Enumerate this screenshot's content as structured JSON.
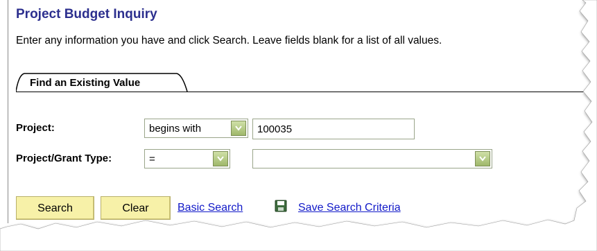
{
  "page": {
    "title": "Project Budget Inquiry",
    "instructions": "Enter any information you have and click Search. Leave fields blank for a list of all values."
  },
  "tab": {
    "label": "Find an Existing Value"
  },
  "form": {
    "project": {
      "label": "Project:",
      "operator": "begins with",
      "value": "100035"
    },
    "grant_type": {
      "label": "Project/Grant Type:",
      "operator": "=",
      "value": ""
    }
  },
  "actions": {
    "search_label": "Search",
    "clear_label": "Clear",
    "basic_search_label": "Basic Search",
    "save_criteria_label": "Save Search Criteria"
  },
  "colors": {
    "title": "#2c2f8e",
    "button_bg": "#f7f1a8",
    "link": "#1018c8",
    "dropdown_button": "#9fb86a"
  },
  "icons": {
    "dropdown": "chevron-down-icon",
    "save": "floppy-disk-icon"
  }
}
